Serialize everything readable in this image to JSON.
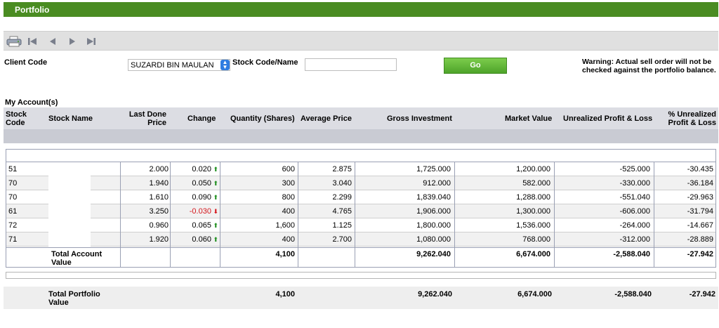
{
  "title": "Portfolio",
  "toolbar": {
    "print_icon": "printer-icon",
    "first_icon": "first-page-icon",
    "prev_icon": "previous-page-icon",
    "next_icon": "next-page-icon",
    "last_icon": "last-page-icon"
  },
  "filters": {
    "client_label": "Client Code",
    "client_value": "SUZARDI BIN MAULAN",
    "stock_label": "Stock Code/Name",
    "stock_value": "",
    "go_label": "Go",
    "warning": "Warning: Actual sell order will not be checked against the portfolio balance."
  },
  "section_title": "My Account(s)",
  "columns": {
    "code": [
      "Stock",
      "Code"
    ],
    "name": "Stock Name",
    "last_done": [
      "Last Done",
      "Price"
    ],
    "change": "Change",
    "quantity": "Quantity (Shares)",
    "avg_price": "Average Price",
    "gross": "Gross Investment",
    "market": "Market Value",
    "upl": "Unrealized Profit & Loss",
    "upl_pct": [
      "% Unrealized",
      "Profit & Loss"
    ]
  },
  "rows": [
    {
      "code": "51",
      "last": "2.000",
      "change": "0.020",
      "dir": "up",
      "qty": "600",
      "avg": "2.875",
      "gross": "1,725.000",
      "market": "1,200.000",
      "upl": "-525.000",
      "pct": "-30.435"
    },
    {
      "code": "70",
      "last": "1.940",
      "change": "0.050",
      "dir": "up",
      "qty": "300",
      "avg": "3.040",
      "gross": "912.000",
      "market": "582.000",
      "upl": "-330.000",
      "pct": "-36.184"
    },
    {
      "code": "70",
      "last": "1.610",
      "change": "0.090",
      "dir": "up",
      "qty": "800",
      "avg": "2.299",
      "gross": "1,839.040",
      "market": "1,288.000",
      "upl": "-551.040",
      "pct": "-29.963"
    },
    {
      "code": "61",
      "last": "3.250",
      "change": "-0.030",
      "dir": "down",
      "qty": "400",
      "avg": "4.765",
      "gross": "1,906.000",
      "market": "1,300.000",
      "upl": "-606.000",
      "pct": "-31.794"
    },
    {
      "code": "72",
      "last": "0.960",
      "change": "0.065",
      "dir": "up",
      "qty": "1,600",
      "avg": "1.125",
      "gross": "1,800.000",
      "market": "1,536.000",
      "upl": "-264.000",
      "pct": "-14.667"
    },
    {
      "code": "71",
      "last": "1.920",
      "change": "0.060",
      "dir": "up",
      "qty": "400",
      "avg": "2.700",
      "gross": "1,080.000",
      "market": "768.000",
      "upl": "-312.000",
      "pct": "-28.889"
    }
  ],
  "account_total": {
    "label": [
      "Total Account",
      "Value"
    ],
    "qty": "4,100",
    "gross": "9,262.040",
    "market": "6,674.000",
    "upl": "-2,588.040",
    "pct": "-27.942"
  },
  "portfolio_total": {
    "label": [
      "Total Portfolio",
      "Value"
    ],
    "qty": "4,100",
    "gross": "9,262.040",
    "market": "6,674.000",
    "upl": "-2,588.040",
    "pct": "-27.942"
  },
  "colors": {
    "brand": "#4a8c22",
    "header_band": "#dcdde3",
    "negative": "#d4161c",
    "positive": "#1f8f1f"
  }
}
